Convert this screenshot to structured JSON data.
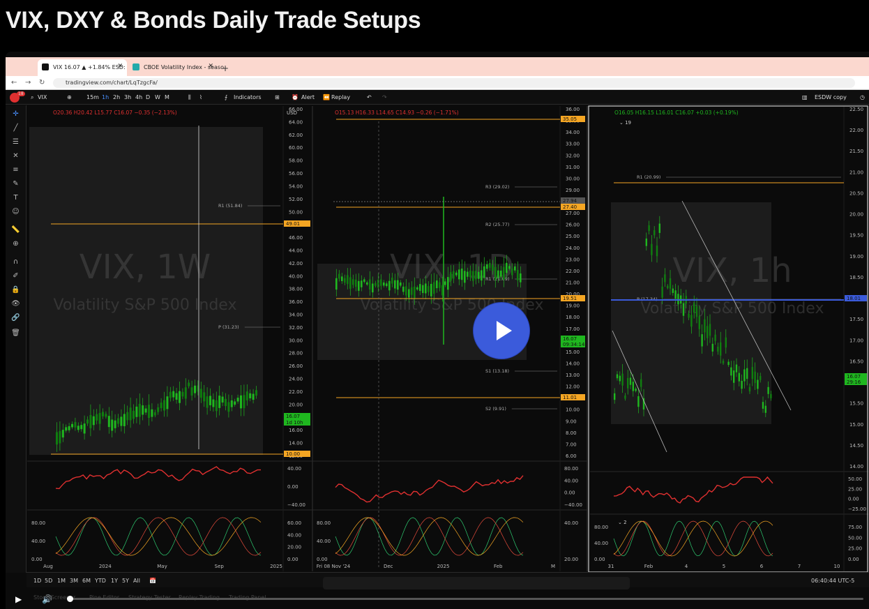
{
  "page": {
    "title": "VIX, DXY & Bonds Daily Trade Setups"
  },
  "browser": {
    "tabs": [
      {
        "label": "VIX 16.07 ▲ +1.84% ESD:"
      },
      {
        "label": "CBOE Volatility Index - seaso"
      }
    ],
    "new_tab": "+",
    "url": "tradingview.com/chart/LqTzgcFa/"
  },
  "toolbar": {
    "symbol": "VIX",
    "intervals": [
      "15m",
      "1h",
      "2h",
      "3h",
      "4h",
      "D",
      "W",
      "M"
    ],
    "indicators": "Indicators",
    "alert": "Alert",
    "replay": "Replay",
    "layout_name": "ESDW copy",
    "notification_count": "18"
  },
  "panels": [
    {
      "watermark": "VIX, 1W",
      "subtitle": "Volatility S&P 500 Index",
      "ohlc": {
        "o": "O20.36",
        "h": "H20.42",
        "l": "L15.77",
        "c": "C16.07",
        "chg": "−0.35 (−2.13%)"
      },
      "currency": "USD",
      "price_ticks": [
        "66.00",
        "64.00",
        "62.00",
        "60.00",
        "58.00",
        "56.00",
        "54.00",
        "52.00",
        "50.00",
        "48.00",
        "46.00",
        "44.00",
        "42.00",
        "40.00",
        "38.00",
        "36.00",
        "34.00",
        "32.00",
        "30.00",
        "28.00",
        "26.00",
        "24.00",
        "22.00",
        "20.00",
        "18.00",
        "16.00",
        "14.00",
        "12.00"
      ],
      "levels": [
        {
          "label": "R1 (51.84)"
        },
        {
          "label": "P (31.23)"
        }
      ],
      "price_tags": [
        "49.01",
        "16.07",
        "1d 10h",
        "10.00"
      ],
      "osc_ticks": [
        "40.00",
        "0.00",
        "−40.00"
      ],
      "stoch_ticks": [
        "80.00",
        "40.00",
        "0.00",
        "60.00",
        "40.00",
        "20.00",
        "0.00"
      ],
      "time_labels": [
        "Aug",
        "2024",
        "May",
        "Sep",
        "2025"
      ]
    },
    {
      "watermark": "VIX, 1D",
      "subtitle": "Volatility S&P 500 Index",
      "ohlc": {
        "o": "O15.13",
        "h": "H16.33",
        "l": "L14.65",
        "c": "C14.93",
        "chg": "−0.26 (−1.71%)"
      },
      "price_ticks": [
        "36.00",
        "35.00",
        "34.00",
        "33.00",
        "32.00",
        "31.00",
        "30.00",
        "29.00",
        "28.00",
        "27.00",
        "26.00",
        "25.00",
        "24.00",
        "23.00",
        "22.00",
        "21.00",
        "20.00",
        "19.00",
        "18.00",
        "17.00",
        "16.00",
        "15.00",
        "14.00",
        "13.00",
        "12.00",
        "11.00",
        "10.00",
        "9.00",
        "8.00",
        "7.00",
        "6.00"
      ],
      "levels": [
        {
          "label": "R3 (29.02)"
        },
        {
          "label": "R2 (25.77)"
        },
        {
          "label": "R1 (21.09)"
        },
        {
          "label": "S1 (13.18)"
        },
        {
          "label": "S2 (9.91)"
        }
      ],
      "price_tags": [
        "35.05",
        "27.94",
        "27.40",
        "19.51",
        "16.07",
        "09:34:14",
        "11.01"
      ],
      "osc_ticks": [
        "80.00",
        "40.00",
        "0.00",
        "−40.00"
      ],
      "stoch_ticks": [
        "80.00",
        "40.00",
        "0.00",
        "40.00",
        "20.00"
      ],
      "time_labels": [
        "Fri 08 Nov '24",
        "Dec",
        "2025",
        "Feb",
        "M"
      ]
    },
    {
      "watermark": "VIX, 1h",
      "subtitle": "Volatility S&P 500 Index",
      "ohlc": {
        "o": "O16.05",
        "h": "H16.15",
        "l": "L16.01",
        "c": "C16.07",
        "chg": "+0.03 (+0.19%)"
      },
      "badge": "19",
      "price_ticks": [
        "22.50",
        "22.00",
        "21.50",
        "21.00",
        "20.50",
        "20.00",
        "19.50",
        "19.00",
        "18.50",
        "18.00",
        "17.50",
        "17.00",
        "16.50",
        "16.00",
        "15.50",
        "15.00",
        "14.50",
        "14.00"
      ],
      "levels": [
        {
          "label": "R1 (20.99)"
        },
        {
          "label": "P (17.34)"
        }
      ],
      "price_tags": [
        "18.01",
        "16.07",
        "29:16"
      ],
      "osc_ticks": [
        "50.00",
        "25.00",
        "0.00",
        "−25.00"
      ],
      "stoch_badge": "2",
      "stoch_ticks": [
        "80.00",
        "40.00",
        "0.00",
        "75.00",
        "50.00",
        "25.00",
        "0.00"
      ],
      "time_labels": [
        "31",
        "Feb",
        "4",
        "5",
        "6",
        "7",
        "10"
      ]
    }
  ],
  "bottom": {
    "ranges": [
      "1D",
      "5D",
      "1M",
      "3M",
      "6M",
      "YTD",
      "1Y",
      "5Y",
      "All"
    ],
    "time": "06:40:44 UTC-5",
    "panels": [
      "Stock Screener",
      "Pine Editor",
      "Strategy Tester",
      "Replay Trading",
      "Trading Panel"
    ]
  },
  "colors": {
    "up": "#26a69a",
    "green": "#1fb71f",
    "red": "#e03030",
    "orange": "#f5a623",
    "blue": "#3b5bdb"
  }
}
